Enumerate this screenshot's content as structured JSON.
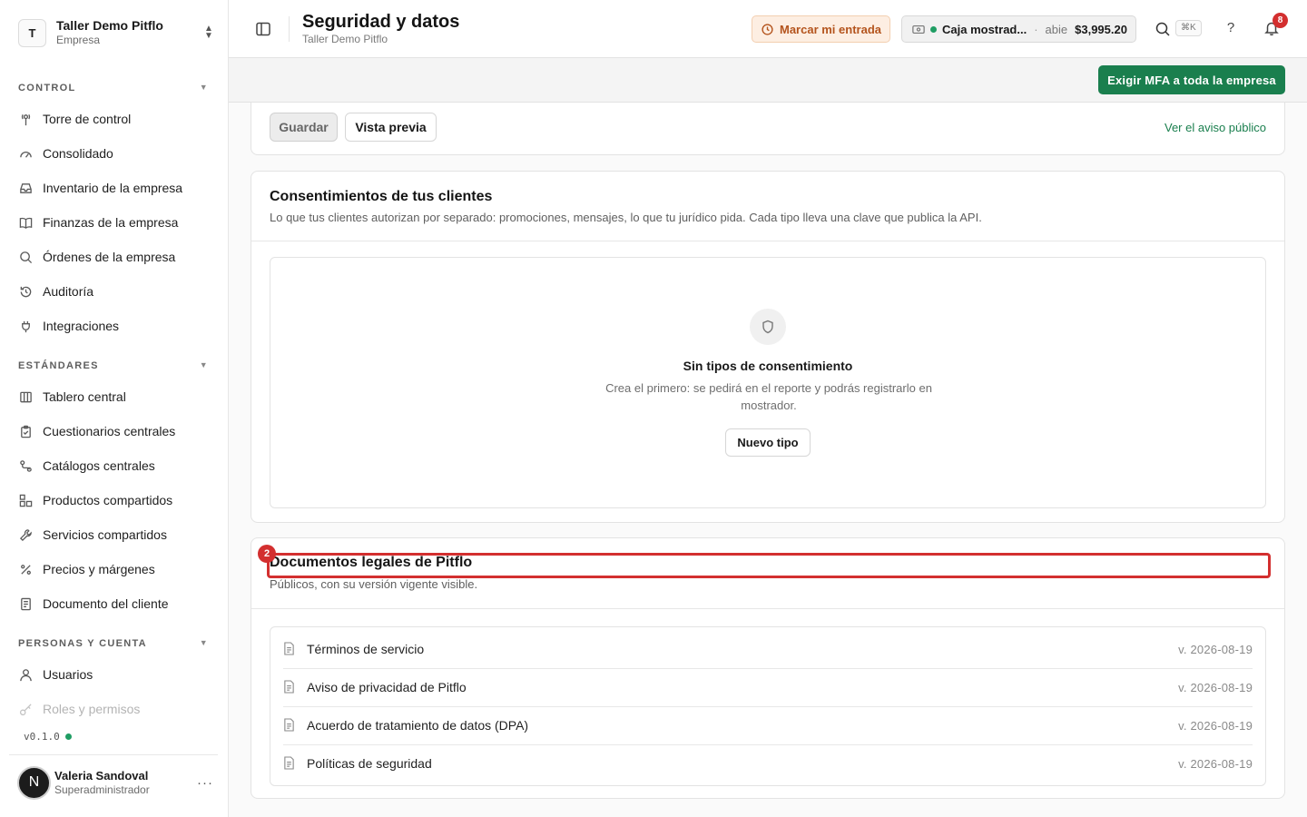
{
  "sidebar": {
    "org": {
      "initial": "T",
      "name": "Taller Demo Pitflo",
      "type": "Empresa"
    },
    "sections": [
      {
        "title": "CONTROL",
        "items": [
          {
            "label": "Torre de control",
            "icon": "antenna-icon"
          },
          {
            "label": "Consolidado",
            "icon": "gauge-icon"
          },
          {
            "label": "Inventario de la empresa",
            "icon": "inbox-icon"
          },
          {
            "label": "Finanzas de la empresa",
            "icon": "book-icon"
          },
          {
            "label": "Órdenes de la empresa",
            "icon": "search-icon"
          },
          {
            "label": "Auditoría",
            "icon": "history-icon"
          },
          {
            "label": "Integraciones",
            "icon": "plug-icon"
          }
        ]
      },
      {
        "title": "ESTÁNDARES",
        "items": [
          {
            "label": "Tablero central",
            "icon": "columns-icon"
          },
          {
            "label": "Cuestionarios centrales",
            "icon": "clipboard-icon"
          },
          {
            "label": "Catálogos centrales",
            "icon": "route-icon"
          },
          {
            "label": "Productos compartidos",
            "icon": "boxes-icon"
          },
          {
            "label": "Servicios compartidos",
            "icon": "wrench-icon"
          },
          {
            "label": "Precios y márgenes",
            "icon": "percent-icon"
          },
          {
            "label": "Documento del cliente",
            "icon": "document-icon"
          }
        ]
      },
      {
        "title": "PERSONAS Y CUENTA",
        "items": [
          {
            "label": "Usuarios",
            "icon": "user-icon"
          },
          {
            "label": "Roles y permisos",
            "icon": "key-icon"
          }
        ]
      }
    ],
    "version": "v0.1.0",
    "user": {
      "initial": "N",
      "name": "Valeria Sandoval",
      "role": "Superadministrador"
    }
  },
  "header": {
    "title": "Seguridad y datos",
    "subtitle": "Taller Demo Pitflo",
    "clock_label": "Marcar mi entrada",
    "register": {
      "name": "Caja mostrad...",
      "separator": "·",
      "state": "abie",
      "amount": "$3,995.20"
    },
    "search_shortcut": "⌘K",
    "help": "?",
    "notifications": "8"
  },
  "actions": {
    "mfa_label": "Exigir MFA a toda la empresa"
  },
  "notice_card": {
    "save_label": "Guardar",
    "preview_label": "Vista previa",
    "public_link": "Ver el aviso público"
  },
  "consents": {
    "title": "Consentimientos de tus clientes",
    "description": "Lo que tus clientes autorizan por separado: promociones, mensajes, lo que tu jurídico pida. Cada tipo lleva una clave que publica la API.",
    "empty_title": "Sin tipos de consentimiento",
    "empty_description": "Crea el primero: se pedirá en el reporte y podrás registrarlo en mostrador.",
    "new_label": "Nuevo tipo"
  },
  "legal": {
    "marker": "2",
    "title": "Documentos legales de Pitflo",
    "description": "Públicos, con su versión vigente visible.",
    "docs": [
      {
        "title": "Términos de servicio",
        "version": "v. 2026-08-19"
      },
      {
        "title": "Aviso de privacidad de Pitflo",
        "version": "v. 2026-08-19"
      },
      {
        "title": "Acuerdo de tratamiento de datos (DPA)",
        "version": "v. 2026-08-19"
      },
      {
        "title": "Políticas de seguridad",
        "version": "v. 2026-08-19"
      }
    ]
  },
  "colors": {
    "accent": "#1a7f4e",
    "warning_bg": "#fdeee2",
    "warning_text": "#b4541d",
    "alert": "#d32f2f"
  }
}
